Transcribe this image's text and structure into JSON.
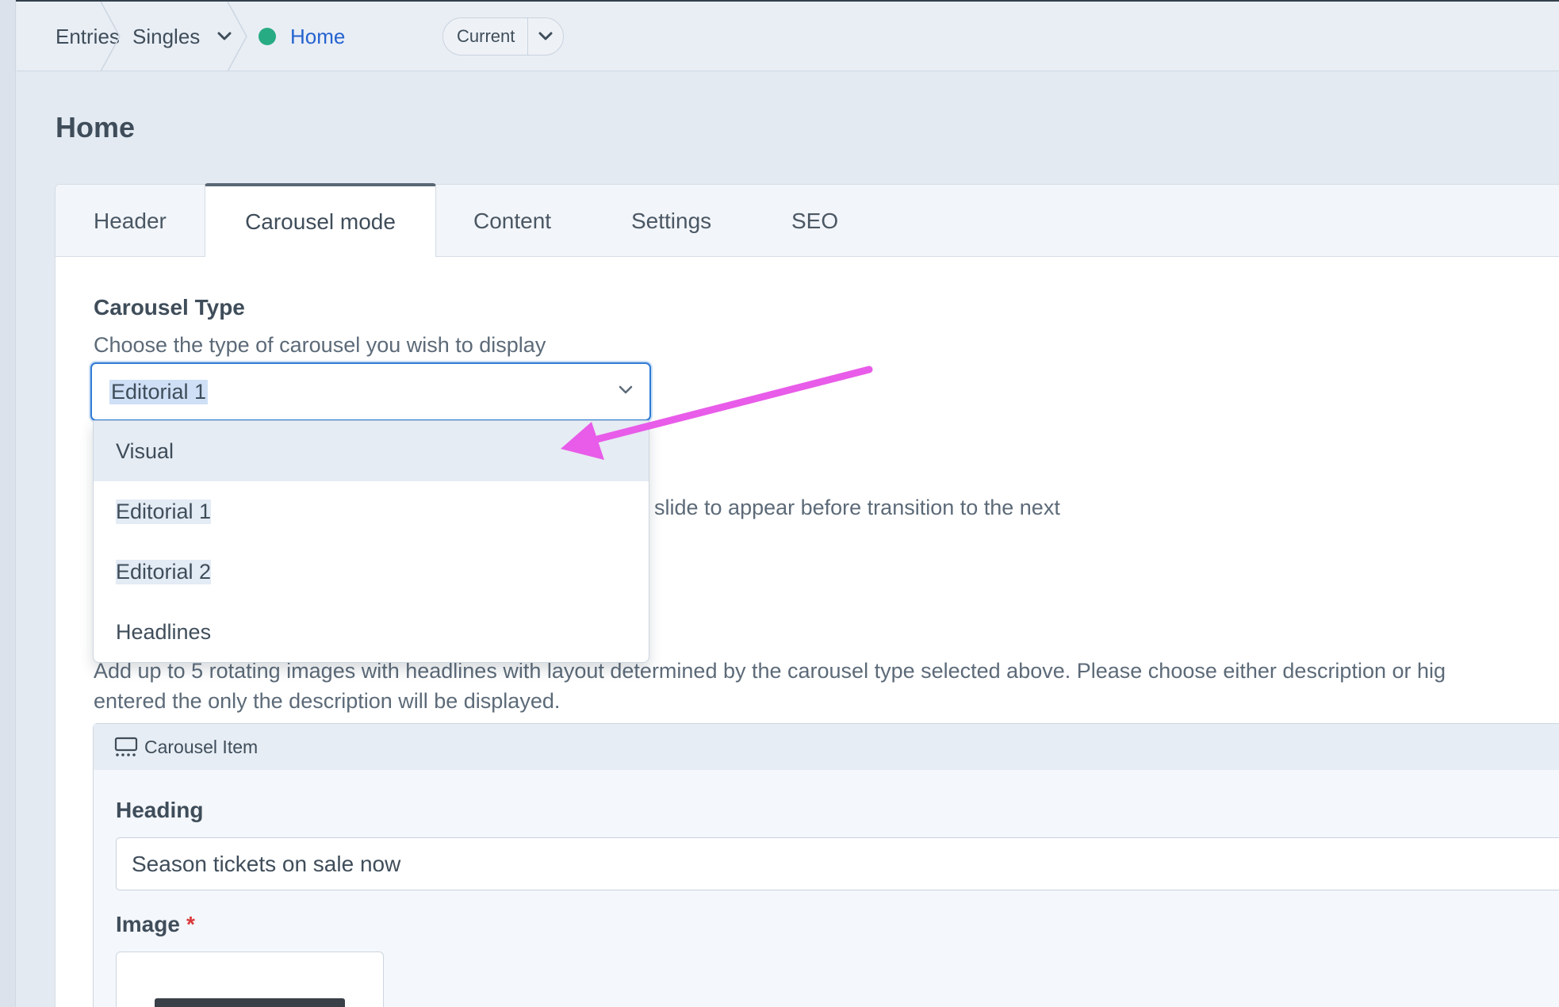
{
  "breadcrumb": {
    "items": [
      "Entries",
      "Singles",
      "Home"
    ],
    "revision_label": "Current"
  },
  "page_title": "Home",
  "tabs": [
    {
      "label": "Header"
    },
    {
      "label": "Carousel mode"
    },
    {
      "label": "Content"
    },
    {
      "label": "Settings"
    },
    {
      "label": "SEO"
    }
  ],
  "carousel_type": {
    "label": "Carousel Type",
    "instructions": "Choose the type of carousel you wish to display",
    "selected": "Editorial 1",
    "options": [
      "Visual",
      "Editorial 1",
      "Editorial 2",
      "Headlines"
    ]
  },
  "slide_duration": {
    "instructions_partial": "slide to appear before transition to the next"
  },
  "carousel_items": {
    "instructions_line1": "Add up to 5 rotating images with headlines with layout determined by the carousel type selected above. Please choose either description or hig",
    "instructions_line2": "entered the only the description will be displayed.",
    "block_title": "Carousel Item",
    "heading_label": "Heading",
    "heading_value": "Season tickets on sale now",
    "image_label": "Image",
    "required_mark": "*"
  },
  "colors": {
    "status_live": "#27ab83",
    "link": "#2563d0",
    "focus": "#2f7bd6",
    "annotation_arrow": "#e85ce9",
    "required": "#d93a3a"
  }
}
